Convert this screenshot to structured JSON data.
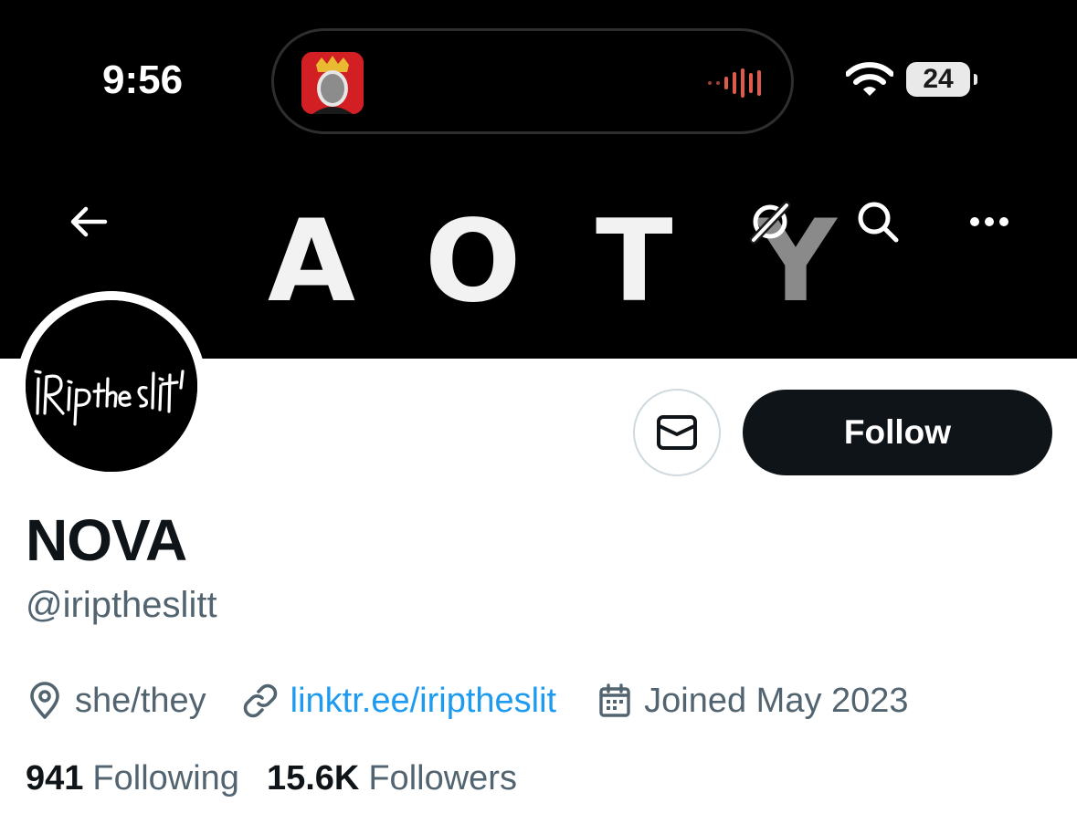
{
  "status_bar": {
    "time": "9:56",
    "battery": "24"
  },
  "banner": {
    "letters": [
      "A",
      "O",
      "T",
      "Y"
    ]
  },
  "avatar": {
    "logo_text": "iRip the slit"
  },
  "profile": {
    "display_name": "NOVA",
    "handle": "@iriptheslitt",
    "pronouns": "she/they",
    "link": "linktr.ee/iriptheslit",
    "joined": "Joined May 2023"
  },
  "stats": {
    "following_count": "941",
    "following_label": "Following",
    "followers_count": "15.6K",
    "followers_label": "Followers"
  },
  "actions": {
    "follow_label": "Follow"
  },
  "icons": {
    "back": "back-arrow-icon",
    "hide": "eye-slash-icon",
    "search": "search-icon",
    "more": "more-icon",
    "message": "envelope-icon",
    "location": "location-pin-icon",
    "link": "link-icon",
    "calendar": "calendar-icon"
  },
  "colors": {
    "accent": "#1d9bf0",
    "text_primary": "#0f1419",
    "text_secondary": "#536471",
    "follow_bg": "#0f1419"
  }
}
